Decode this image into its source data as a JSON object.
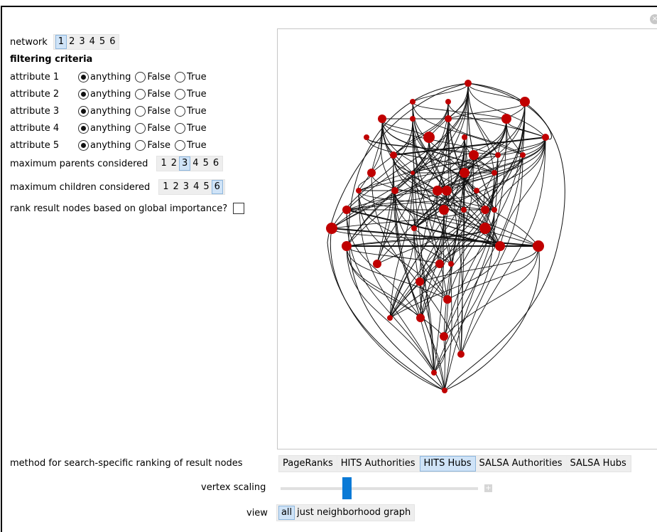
{
  "network": {
    "label": "network",
    "options": [
      "1",
      "2",
      "3",
      "4",
      "5",
      "6"
    ],
    "selected": "1"
  },
  "filtering": {
    "title": "filtering criteria",
    "attributes": [
      {
        "label": "attribute 1",
        "options": [
          "anything",
          "False",
          "True"
        ],
        "selected": "anything"
      },
      {
        "label": "attribute 2",
        "options": [
          "anything",
          "False",
          "True"
        ],
        "selected": "anything"
      },
      {
        "label": "attribute 3",
        "options": [
          "anything",
          "False",
          "True"
        ],
        "selected": "anything"
      },
      {
        "label": "attribute 4",
        "options": [
          "anything",
          "False",
          "True"
        ],
        "selected": "anything"
      },
      {
        "label": "attribute 5",
        "options": [
          "anything",
          "False",
          "True"
        ],
        "selected": "anything"
      }
    ]
  },
  "max_parents": {
    "label": "maximum parents considered",
    "options": [
      "1",
      "2",
      "3",
      "4",
      "5",
      "6"
    ],
    "selected": "3"
  },
  "max_children": {
    "label": "maximum children considered",
    "options": [
      "1",
      "2",
      "3",
      "4",
      "5",
      "6"
    ],
    "selected": "6"
  },
  "rank_global": {
    "label": "rank result nodes based on global importance?",
    "checked": false
  },
  "method": {
    "label": "method for search-specific ranking of result nodes",
    "options": [
      "PageRanks",
      "HITS Authorities",
      "HITS Hubs",
      "SALSA Authorities",
      "SALSA Hubs"
    ],
    "selected": "HITS Hubs"
  },
  "vertex_scaling": {
    "label": "vertex scaling",
    "value": 0.32
  },
  "view": {
    "label": "view",
    "options": [
      "all",
      "just neighborhood graph"
    ],
    "selected": "all"
  },
  "colors": {
    "node": "#c00000",
    "selected_bg": "#cfe3f7",
    "slider": "#0a7ad6"
  }
}
